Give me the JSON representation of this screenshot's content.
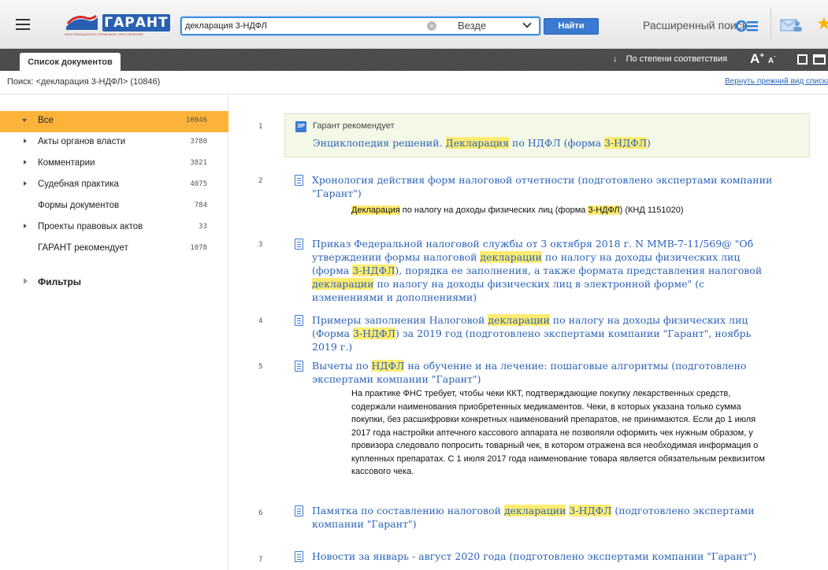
{
  "header": {
    "logo_text": "ГАРАНТ",
    "logo_subtitle": "ИНФОРМАЦИОННО-ПРАВОВОЕ ОБЕСПЕЧЕНИЕ",
    "search_value": "декларация 3-НДФЛ",
    "scope_value": "Везде",
    "find_label": "Найти",
    "advanced_search": "Расширенный поиск",
    "icons": {
      "menu": "hamburger-icon",
      "clear": "clear-icon",
      "advanced": "list-search-icon",
      "mail": "mail-icon",
      "star": "star-icon"
    }
  },
  "toolbar": {
    "tab_label": "Список документов",
    "sort_label": "По степени соответствия",
    "font_size_label": "A",
    "font_large_sup": "+",
    "font_small": "A",
    "font_small_sup": "-"
  },
  "infoline": {
    "query": "Поиск: <декларация 3-НДФЛ> (10846)",
    "restore_link": "Вернуть прежний вид списка"
  },
  "sidebar": {
    "items": [
      {
        "label": "Все",
        "count": "10846",
        "expandable": true,
        "active": true
      },
      {
        "label": "Акты органов власти",
        "count": "3780",
        "expandable": true
      },
      {
        "label": "Комментарии",
        "count": "3821",
        "expandable": true
      },
      {
        "label": "Судебная практика",
        "count": "4075",
        "expandable": true
      },
      {
        "label": "Формы документов",
        "count": "784",
        "expandable": false
      },
      {
        "label": "Проекты правовых актов",
        "count": "33",
        "expandable": true
      },
      {
        "label": "ГАРАНТ рекомендует",
        "count": "1078",
        "expandable": false
      }
    ],
    "filters_label": "Фильтры"
  },
  "results": {
    "recommend": {
      "num": "1",
      "icon_text": "ЭР",
      "label": "Гарант рекомендует",
      "title_parts": [
        "Энциклопедия решений. ",
        "Декларация",
        " по НДФЛ (форма ",
        "3-НДФЛ",
        ")"
      ]
    },
    "items": [
      {
        "num": "2",
        "title": "Хронология действия форм налоговой отчетности (подготовлено экспертами компании \"Гарант\")",
        "snippet_parts": [
          "Декларация",
          " по налогу на доходы физических лиц (форма ",
          "3-НДФЛ",
          ") (КНД 1151020)"
        ]
      },
      {
        "num": "3",
        "title_parts": [
          "Приказ Федеральной налоговой службы от 3 октября 2018 г. N ММВ-7-11/569@ \"Об утверждении формы налоговой ",
          "декларации",
          " по налогу на доходы физических лиц (форма ",
          "3-НДФЛ",
          "), порядка ее заполнения, а также формата представления налоговой ",
          "декларации",
          " по налогу на доходы физических лиц в электронной форме\" (с изменениями и дополнениями)"
        ]
      },
      {
        "num": "4",
        "title_parts": [
          "Примеры заполнения Налоговой ",
          "декларации",
          " по налогу на доходы физических лиц (Форма ",
          "3-НДФЛ",
          ") за 2019 год (подготовлено экспертами компании \"Гарант\", ноябрь 2019 г.)"
        ]
      },
      {
        "num": "5",
        "title_parts": [
          "Вычеты по ",
          "НДФЛ",
          " на обучение и на лечение: пошаговые алгоритмы (подготовлено экспертами компании \"Гарант\")"
        ],
        "snippet": "На практике ФНС требует, чтобы чеки ККТ, подтверждающие покупку лекарственных средств, содержали наименования приобретенных медикаментов. Чеки, в которых указана только сумма покупки, без расшифровки конкретных наименований препаратов, не принимаются. Если до 1 июля 2017 года настройки аптечного кассового аппарата не позволяли оформить чек нужным образом, у провизора следовало попросить товарный чек, в котором отражена вся необходимая информация о купленных препаратах. С 1 июля 2017 года наименование товара является обязательным реквизитом кассового чека."
      },
      {
        "num": "6",
        "title_parts": [
          "Памятка по составлению налоговой ",
          "декларации",
          " ",
          "3-НДФЛ",
          " (подготовлено экспертами компании \"Гарант\")"
        ]
      },
      {
        "num": "7",
        "title": "Новости за январь - август 2020 года (подготовлено экспертами компании \"Гарант\")"
      }
    ]
  },
  "colors": {
    "accent": "#3b7ad1",
    "active_row": "#fcb33a",
    "highlight": "#ffec70",
    "link": "#2b63b8",
    "darkbar": "#4a4a4a"
  }
}
